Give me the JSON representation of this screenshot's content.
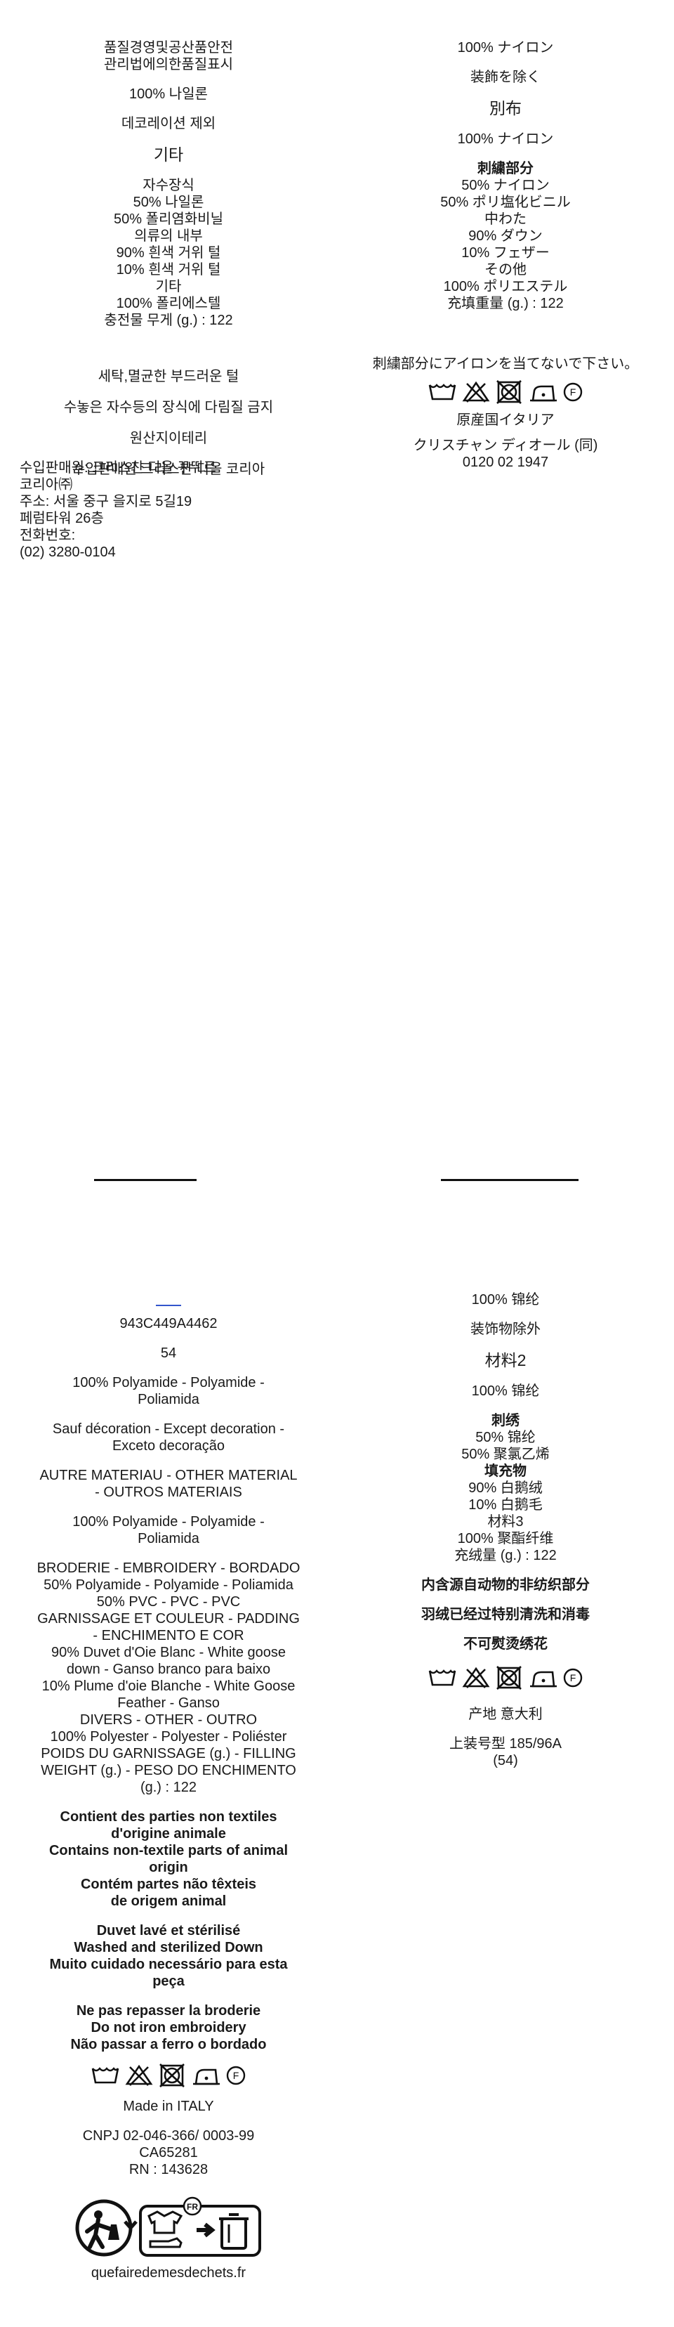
{
  "ko": {
    "header": [
      "품질경영및공산품안전",
      "관리법에의한품질표시"
    ],
    "comp1": "100% 나일론",
    "exc": "데코레이션 제외",
    "other_title": "기타",
    "emb_list": [
      "자수장식",
      "50% 나일론",
      "50% 폴리염화비닐",
      "의류의 내부",
      "90% 흰색 거위 털",
      "10% 흰색 거위 털",
      "기타",
      "100% 폴리에스텔",
      "충전물 무게 (g.) : 122"
    ],
    "care": [
      "세탁,멸균한 부드러운 털",
      "수놓은 자수등의 장식에 다림질 금지",
      "원산지이테리",
      "수입판매원 크리스챤 디올 코리아"
    ],
    "address": [
      "수입판매원: 크리스챤 디올 꾸뛰르",
      "코리아㈜",
      "주소: 서울 중구 을지로 5길19",
      "페럼타워 26층",
      "전화번호:",
      "(02) 3280-0104"
    ]
  },
  "ja": {
    "comp1": "100% ナイロン",
    "exc": "装飾を除く",
    "other_title": "別布",
    "comp2": "100% ナイロン",
    "emb_list": [
      "刺繍部分",
      "50% ナイロン",
      "50% ポリ塩化ビニル",
      "中わた",
      "90% ダウン",
      "10% フェザー",
      "その他",
      "100% ポリエステル",
      "充填重量 (g.) : 122"
    ],
    "iron": "刺繍部分にアイロンを当てないで下さい。",
    "origin": "原産国イタリア",
    "company": "クリスチャン ディオール (同)",
    "phone": "0120 02 1947"
  },
  "fr": {
    "ref": "943C449A4462",
    "size": "54",
    "comp1": [
      "100% Polyamide - Polyamide -",
      "Poliamida"
    ],
    "exc": [
      "Sauf décoration - Except decoration -",
      "Exceto decoração"
    ],
    "other": [
      "AUTRE MATERIAU - OTHER MATERIAL",
      "- OUTROS MATERIAIS"
    ],
    "comp2": [
      "100% Polyamide - Polyamide -",
      "Poliamida"
    ],
    "emb": [
      "BRODERIE - EMBROIDERY - BORDADO",
      "50% Polyamide - Polyamide - Poliamida",
      "50% PVC - PVC - PVC",
      "GARNISSAGE ET COULEUR - PADDING",
      "- ENCHIMENTO E COR",
      "90% Duvet d'Oie Blanc - White goose",
      "down - Ganso branco para baixo",
      "10% Plume d'oie Blanche - White Goose",
      "Feather - Ganso",
      "DIVERS - OTHER - OUTRO",
      "100% Polyester - Polyester - Poliéster",
      "POIDS DU GARNISSAGE (g.) - FILLING",
      "WEIGHT (g.) - PESO DO ENCHIMENTO",
      "(g.) : 122"
    ],
    "animal": [
      "Contient des parties non textiles",
      "d'origine animale",
      "Contains non-textile parts of animal",
      "origin",
      "Contém partes não têxteis",
      "de origem animal"
    ],
    "down": [
      "Duvet lavé et stérilisé",
      "Washed and sterilized Down",
      "Muito cuidado necessário para esta",
      "peça"
    ],
    "iron": [
      "Ne pas repasser la broderie",
      "Do not iron embroidery",
      "Não passar a ferro o bordado"
    ],
    "made": "Made in ITALY",
    "cnpj": [
      "CNPJ  02-046-366/ 0003-99",
      "CA65281",
      "RN : 143628"
    ],
    "triman_url": "quefairedemesdechets.fr",
    "fr_badge": "FR"
  },
  "zh": {
    "comp1": "100% 锦纶",
    "exc": "装饰物除外",
    "mat2": "材料2",
    "comp2": "100% 锦纶",
    "emb_list": [
      "刺绣",
      "50% 锦纶",
      "50% 聚氯乙烯",
      "填充物",
      "90% 白鹅绒",
      "10% 白鹅毛",
      "材料3",
      "100% 聚酯纤维",
      "充绒量 (g.) : 122"
    ],
    "p1": "内含源自动物的非纺织部分",
    "p2": "羽绒已经过特别清洗和消毒",
    "p3": "不可熨烫绣花",
    "origin": "产地 意大利",
    "size_label": "上装号型 185/96A",
    "size_paren": "(54)"
  },
  "care_icons": [
    "wash-30-icon",
    "no-bleach-icon",
    "no-tumble-dry-icon",
    "iron-low-icon",
    "professional-clean-f-icon"
  ],
  "care_symbol_letter": "F"
}
